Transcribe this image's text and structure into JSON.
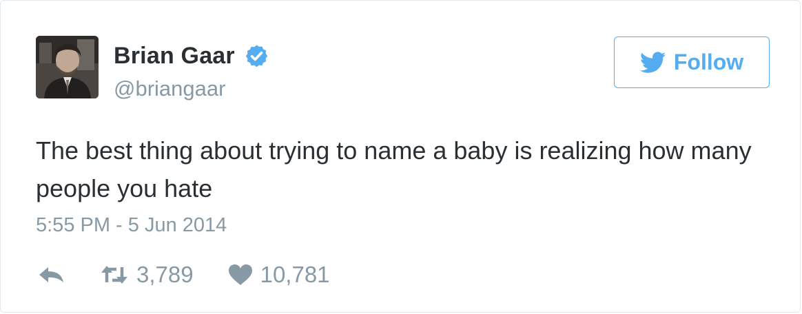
{
  "user": {
    "display_name": "Brian Gaar",
    "handle": "@briangaar",
    "verified_icon": "verified-badge-icon"
  },
  "follow_button": {
    "label": "Follow",
    "icon": "twitter-bird-icon"
  },
  "tweet": {
    "text": "The best thing about trying to name a baby is realizing how many people you hate",
    "timestamp": "5:55 PM - 5 Jun 2014"
  },
  "actions": {
    "reply_icon": "reply-arrow-icon",
    "retweet_icon": "retweet-icon",
    "retweet_count": "3,789",
    "like_icon": "heart-icon",
    "like_count": "10,781"
  },
  "colors": {
    "accent": "#55acee",
    "text": "#292f33",
    "muted": "#8899a6",
    "border": "#e1e8ed"
  }
}
